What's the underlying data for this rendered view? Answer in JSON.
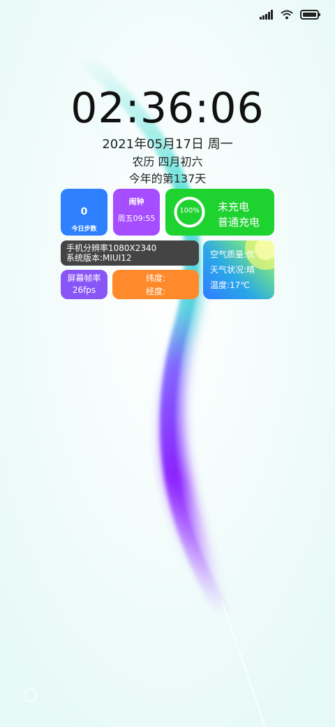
{
  "status": {
    "signal_icon": "signal-icon",
    "wifi_icon": "wifi-icon",
    "battery_icon": "battery-icon"
  },
  "clock": {
    "time": "02:36:06",
    "date": "2021年05月17日 周一",
    "lunar": "农历 四月初六",
    "day_of_year": "今年的第137天"
  },
  "widgets": {
    "steps": {
      "value": "0",
      "label": "今日步数"
    },
    "alarm": {
      "title": "闹钟",
      "time": "周五09:55"
    },
    "battery": {
      "percent": "100%",
      "status": "未充电",
      "mode": "普通充电",
      "level": 1.0
    },
    "system": {
      "resolution": "手机分辨率1080X2340",
      "version": "系统版本:MIUI12"
    },
    "weather": {
      "air_quality": "空气质量:优",
      "condition": "天气状况:晴",
      "temperature": "温度:17℃"
    },
    "fps": {
      "title": "屏幕帧率",
      "value": "26fps"
    },
    "location": {
      "latitude": "纬度:",
      "longitude": "经度:"
    }
  },
  "colors": {
    "steps": "#2e80ff",
    "alarm": "#a64dff",
    "battery": "#1ed230",
    "system": "#444444",
    "fps": "#8a55f7",
    "location": "#ff8a2b"
  }
}
